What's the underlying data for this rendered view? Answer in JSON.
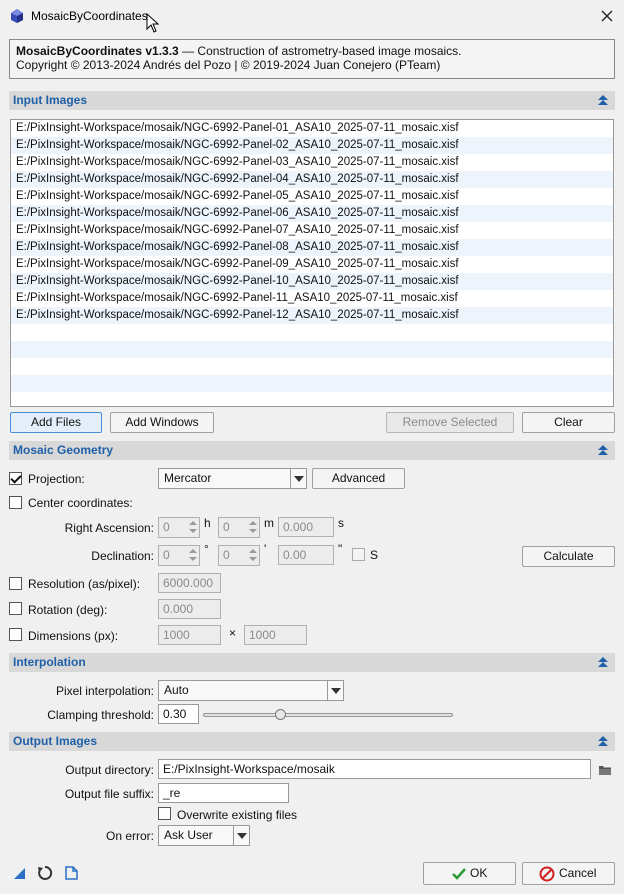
{
  "window": {
    "title": "MosaicByCoordinates",
    "close_glyph": "✕"
  },
  "info": {
    "name": "MosaicByCoordinates v1.3.3",
    "description": " — Construction of astrometry-based image mosaics.",
    "copyright": "Copyright © 2013-2024 Andrés del Pozo | © 2019-2024 Juan Conejero (PTeam)"
  },
  "sections": {
    "input_images": "Input Images",
    "mosaic_geometry": "Mosaic Geometry",
    "interpolation": "Interpolation",
    "output_images": "Output Images"
  },
  "files": [
    "E:/PixInsight-Workspace/mosaik/NGC-6992-Panel-01_ASA10_2025-07-11_mosaic.xisf",
    "E:/PixInsight-Workspace/mosaik/NGC-6992-Panel-02_ASA10_2025-07-11_mosaic.xisf",
    "E:/PixInsight-Workspace/mosaik/NGC-6992-Panel-03_ASA10_2025-07-11_mosaic.xisf",
    "E:/PixInsight-Workspace/mosaik/NGC-6992-Panel-04_ASA10_2025-07-11_mosaic.xisf",
    "E:/PixInsight-Workspace/mosaik/NGC-6992-Panel-05_ASA10_2025-07-11_mosaic.xisf",
    "E:/PixInsight-Workspace/mosaik/NGC-6992-Panel-06_ASA10_2025-07-11_mosaic.xisf",
    "E:/PixInsight-Workspace/mosaik/NGC-6992-Panel-07_ASA10_2025-07-11_mosaic.xisf",
    "E:/PixInsight-Workspace/mosaik/NGC-6992-Panel-08_ASA10_2025-07-11_mosaic.xisf",
    "E:/PixInsight-Workspace/mosaik/NGC-6992-Panel-09_ASA10_2025-07-11_mosaic.xisf",
    "E:/PixInsight-Workspace/mosaik/NGC-6992-Panel-10_ASA10_2025-07-11_mosaic.xisf",
    "E:/PixInsight-Workspace/mosaik/NGC-6992-Panel-11_ASA10_2025-07-11_mosaic.xisf",
    "E:/PixInsight-Workspace/mosaik/NGC-6992-Panel-12_ASA10_2025-07-11_mosaic.xisf"
  ],
  "input_buttons": {
    "add_files": "Add Files",
    "add_windows": "Add Windows",
    "remove_selected": "Remove Selected",
    "clear": "Clear"
  },
  "geometry": {
    "projection_label": "Projection:",
    "projection_checked": true,
    "projection_value": "Mercator",
    "advanced_label": "Advanced",
    "center_label": "Center coordinates:",
    "ra_label": "Right Ascension:",
    "ra_h": "0",
    "ra_h_unit": "h",
    "ra_m": "0",
    "ra_m_unit": "m",
    "ra_s": "0.000",
    "ra_s_unit": "s",
    "dec_label": "Declination:",
    "dec_d": "0",
    "dec_d_unit": "°",
    "dec_m": "0",
    "dec_m_unit": "'",
    "dec_s": "0.00",
    "dec_s_unit": "\"",
    "south_label": "S",
    "calculate_label": "Calculate",
    "resolution_label": "Resolution (as/pixel):",
    "resolution_value": "6000.000",
    "rotation_label": "Rotation (deg):",
    "rotation_value": "0.000",
    "dimensions_label": "Dimensions (px):",
    "width_value": "1000",
    "times_glyph": "×",
    "height_value": "1000"
  },
  "interpolation": {
    "pixel_label": "Pixel interpolation:",
    "pixel_value": "Auto",
    "clamping_label": "Clamping threshold:",
    "clamping_value": "0.30",
    "clamping_fraction": 0.3
  },
  "output": {
    "dir_label": "Output directory:",
    "dir_value": "E:/PixInsight-Workspace/mosaik",
    "suffix_label": "Output file suffix:",
    "suffix_value": "_re",
    "overwrite_label": "Overwrite existing files",
    "overwrite_checked": false,
    "error_label": "On error:",
    "error_value": "Ask User"
  },
  "footer": {
    "ok_label": "OK",
    "cancel_label": "Cancel"
  },
  "colors": {
    "section_title": "#2060a8",
    "ok_check": "#2a9a3a",
    "cancel_icon": "#d02020",
    "accent": "#4a90d8"
  }
}
